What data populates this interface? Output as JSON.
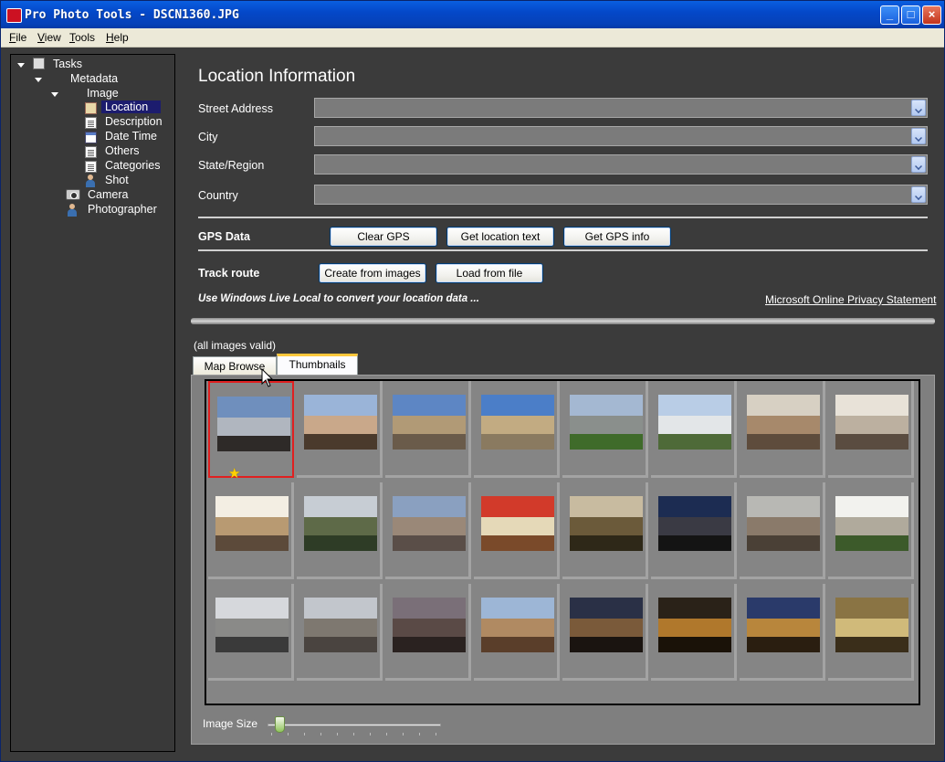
{
  "window": {
    "title": "Pro Photo Tools - DSCN1360.JPG",
    "controls": [
      "_",
      "□",
      "×"
    ]
  },
  "menu": [
    {
      "label": "File",
      "u": "F",
      "rest": "ile"
    },
    {
      "label": "View",
      "u": "V",
      "rest": "iew"
    },
    {
      "label": "Tools",
      "u": "T",
      "rest": "ools"
    },
    {
      "label": "Help",
      "u": "H",
      "rest": "elp"
    }
  ],
  "tree": {
    "tasks": "Tasks",
    "metadata": "Metadata",
    "image": "Image",
    "location": "Location",
    "description": "Description",
    "date_time": "Date Time",
    "others": "Others",
    "categories": "Categories",
    "shot": "Shot",
    "camera": "Camera",
    "photographer": "Photographer"
  },
  "location": {
    "heading": "Location Information",
    "street_label": "Street Address",
    "street_value": "",
    "city_label": "City",
    "city_value": "",
    "state_label": "State/Region",
    "state_value": "",
    "country_label": "Country",
    "country_value": ""
  },
  "gps": {
    "label": "GPS Data",
    "clear": "Clear GPS",
    "get_location_text": "Get location text",
    "get_gps_info": "Get GPS info"
  },
  "track": {
    "label": "Track route",
    "create": "Create from images",
    "load": "Load from file"
  },
  "note": "Use Windows Live Local to convert your location data ...",
  "privacy_link": "Microsoft Online Privacy Statement",
  "images_status": "(all images valid)",
  "tabs": {
    "map_browse": "Map Browse",
    "thumbnails": "Thumbnails",
    "active": "Thumbnails"
  },
  "image_size": {
    "label": "Image Size",
    "level": 0.07
  },
  "thumbnails": {
    "selected_index": 0,
    "starred_index": 0,
    "items": [
      {
        "scene": "train-station",
        "colors": [
          "#6f8fbd",
          "#b0b6bf",
          "#2e2a28"
        ]
      },
      {
        "scene": "palm-street",
        "colors": [
          "#9ab4d8",
          "#c9a88a",
          "#4a3a2c"
        ]
      },
      {
        "scene": "minaret-sky",
        "colors": [
          "#5d86c4",
          "#b19a76",
          "#6a5b4a"
        ]
      },
      {
        "scene": "mosque-square",
        "colors": [
          "#4b7ec8",
          "#c2ab82",
          "#8a7a60"
        ]
      },
      {
        "scene": "coast-field",
        "colors": [
          "#a4b8d2",
          "#8a8f8c",
          "#3f6b2a"
        ]
      },
      {
        "scene": "white-buildings",
        "colors": [
          "#b9cde6",
          "#e3e6e8",
          "#4e6a38"
        ]
      },
      {
        "scene": "mosque-arches",
        "colors": [
          "#d7d0c3",
          "#a7896b",
          "#5e4c3c"
        ]
      },
      {
        "scene": "arch-hall",
        "colors": [
          "#e8e2d8",
          "#bcb0a0",
          "#5a4c40"
        ]
      },
      {
        "scene": "white-arch",
        "colors": [
          "#f3eee3",
          "#b89a72",
          "#5c4a3a"
        ]
      },
      {
        "scene": "palm-park",
        "colors": [
          "#c7cdd4",
          "#5e6a48",
          "#2e3c26"
        ]
      },
      {
        "scene": "station-plaza",
        "colors": [
          "#8aa0c0",
          "#9a8878",
          "#5a4e48"
        ]
      },
      {
        "scene": "snack-wrappers",
        "colors": [
          "#d23a2a",
          "#e5d9b8",
          "#7a4a2a"
        ]
      },
      {
        "scene": "sandwich",
        "colors": [
          "#c8bba0",
          "#6b5a3a",
          "#2e2818"
        ]
      },
      {
        "scene": "dusk-tower",
        "colors": [
          "#1c2c52",
          "#3a3a44",
          "#141414"
        ]
      },
      {
        "scene": "street-cars",
        "colors": [
          "#b8b8b4",
          "#8a7a6a",
          "#4a4036"
        ]
      },
      {
        "scene": "garden-house",
        "colors": [
          "#f2f2ee",
          "#b0aa9c",
          "#3c5a2a"
        ]
      },
      {
        "scene": "city-street",
        "colors": [
          "#d6d8dc",
          "#8a8a88",
          "#3a3a3a"
        ]
      },
      {
        "scene": "avenue",
        "colors": [
          "#c2c6cc",
          "#7e7870",
          "#4a4440"
        ]
      },
      {
        "scene": "harbor-dusk",
        "colors": [
          "#7a6f78",
          "#5a4a46",
          "#2a2220"
        ]
      },
      {
        "scene": "city-gate",
        "colors": [
          "#9db6d6",
          "#b08a62",
          "#5a3e2a"
        ]
      },
      {
        "scene": "market-evening",
        "colors": [
          "#2a3046",
          "#7a5a3a",
          "#1a1410"
        ]
      },
      {
        "scene": "night-alley",
        "colors": [
          "#2a2218",
          "#b0782c",
          "#1a1208"
        ]
      },
      {
        "scene": "night-lane",
        "colors": [
          "#2a3a6a",
          "#b8863c",
          "#2a1e10"
        ]
      },
      {
        "scene": "courtyard",
        "colors": [
          "#8a7444",
          "#d0ba7a",
          "#3a2e1a"
        ]
      }
    ]
  }
}
